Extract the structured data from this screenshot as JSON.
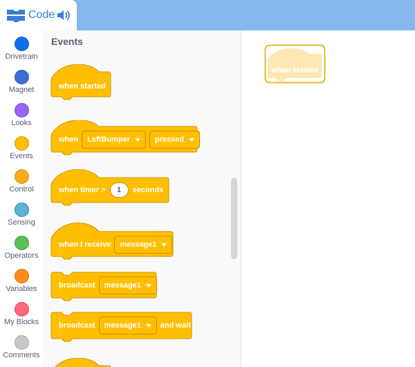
{
  "header": {
    "tab_label": "Code",
    "tab_icon": "code-blocks-icon",
    "sound_icon": "speaker-icon"
  },
  "categories": [
    {
      "label": "Drivetrain",
      "color": "#0f6ff0"
    },
    {
      "label": "Magnet",
      "color": "#3a6fd0"
    },
    {
      "label": "Looks",
      "color": "#9966ff"
    },
    {
      "label": "Events",
      "color": "#ffbf00"
    },
    {
      "label": "Control",
      "color": "#ffab19"
    },
    {
      "label": "Sensing",
      "color": "#5cb1d6"
    },
    {
      "label": "Operators",
      "color": "#59c059"
    },
    {
      "label": "Variables",
      "color": "#ff8c1a"
    },
    {
      "label": "My Blocks",
      "color": "#ff6680"
    },
    {
      "label": "Comments",
      "color": "#c8c8c8"
    }
  ],
  "flyout": {
    "title": "Events",
    "blocks": {
      "when_started": {
        "text": "when started"
      },
      "when_pressed": {
        "prefix": "when",
        "controller": "LeftBumper",
        "action": "pressed"
      },
      "when_timer": {
        "prefix": "when timer >",
        "value": "1",
        "suffix": "seconds"
      },
      "when_receive": {
        "prefix": "when I receive",
        "message": "message1"
      },
      "broadcast": {
        "prefix": "broadcast",
        "message": "message1"
      },
      "broadcast_wait": {
        "prefix": "broadcast",
        "message": "message1",
        "suffix": "and wait"
      }
    }
  },
  "workspace": {
    "ghost_block": {
      "text": "when started"
    }
  },
  "colors": {
    "events_block": "#ffbf00",
    "events_border": "#cf9500",
    "header_bar": "#84b8ec",
    "accent": "#3b7fd6"
  }
}
